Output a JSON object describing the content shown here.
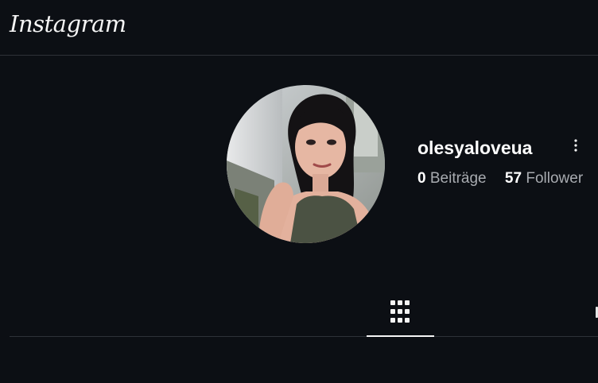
{
  "header": {
    "logo_text": "Instagram"
  },
  "profile": {
    "username": "olesyaloveua",
    "avatar_alt": "profile photo",
    "stats": [
      {
        "value": "0",
        "label": "Beiträge"
      },
      {
        "value": "57",
        "label": "Follower"
      }
    ]
  },
  "tabs": {
    "active": "posts-grid"
  },
  "colors": {
    "background": "#0c0f14",
    "divider": "#2e3238",
    "text_primary": "#ffffff",
    "text_secondary": "#a8abb0"
  }
}
